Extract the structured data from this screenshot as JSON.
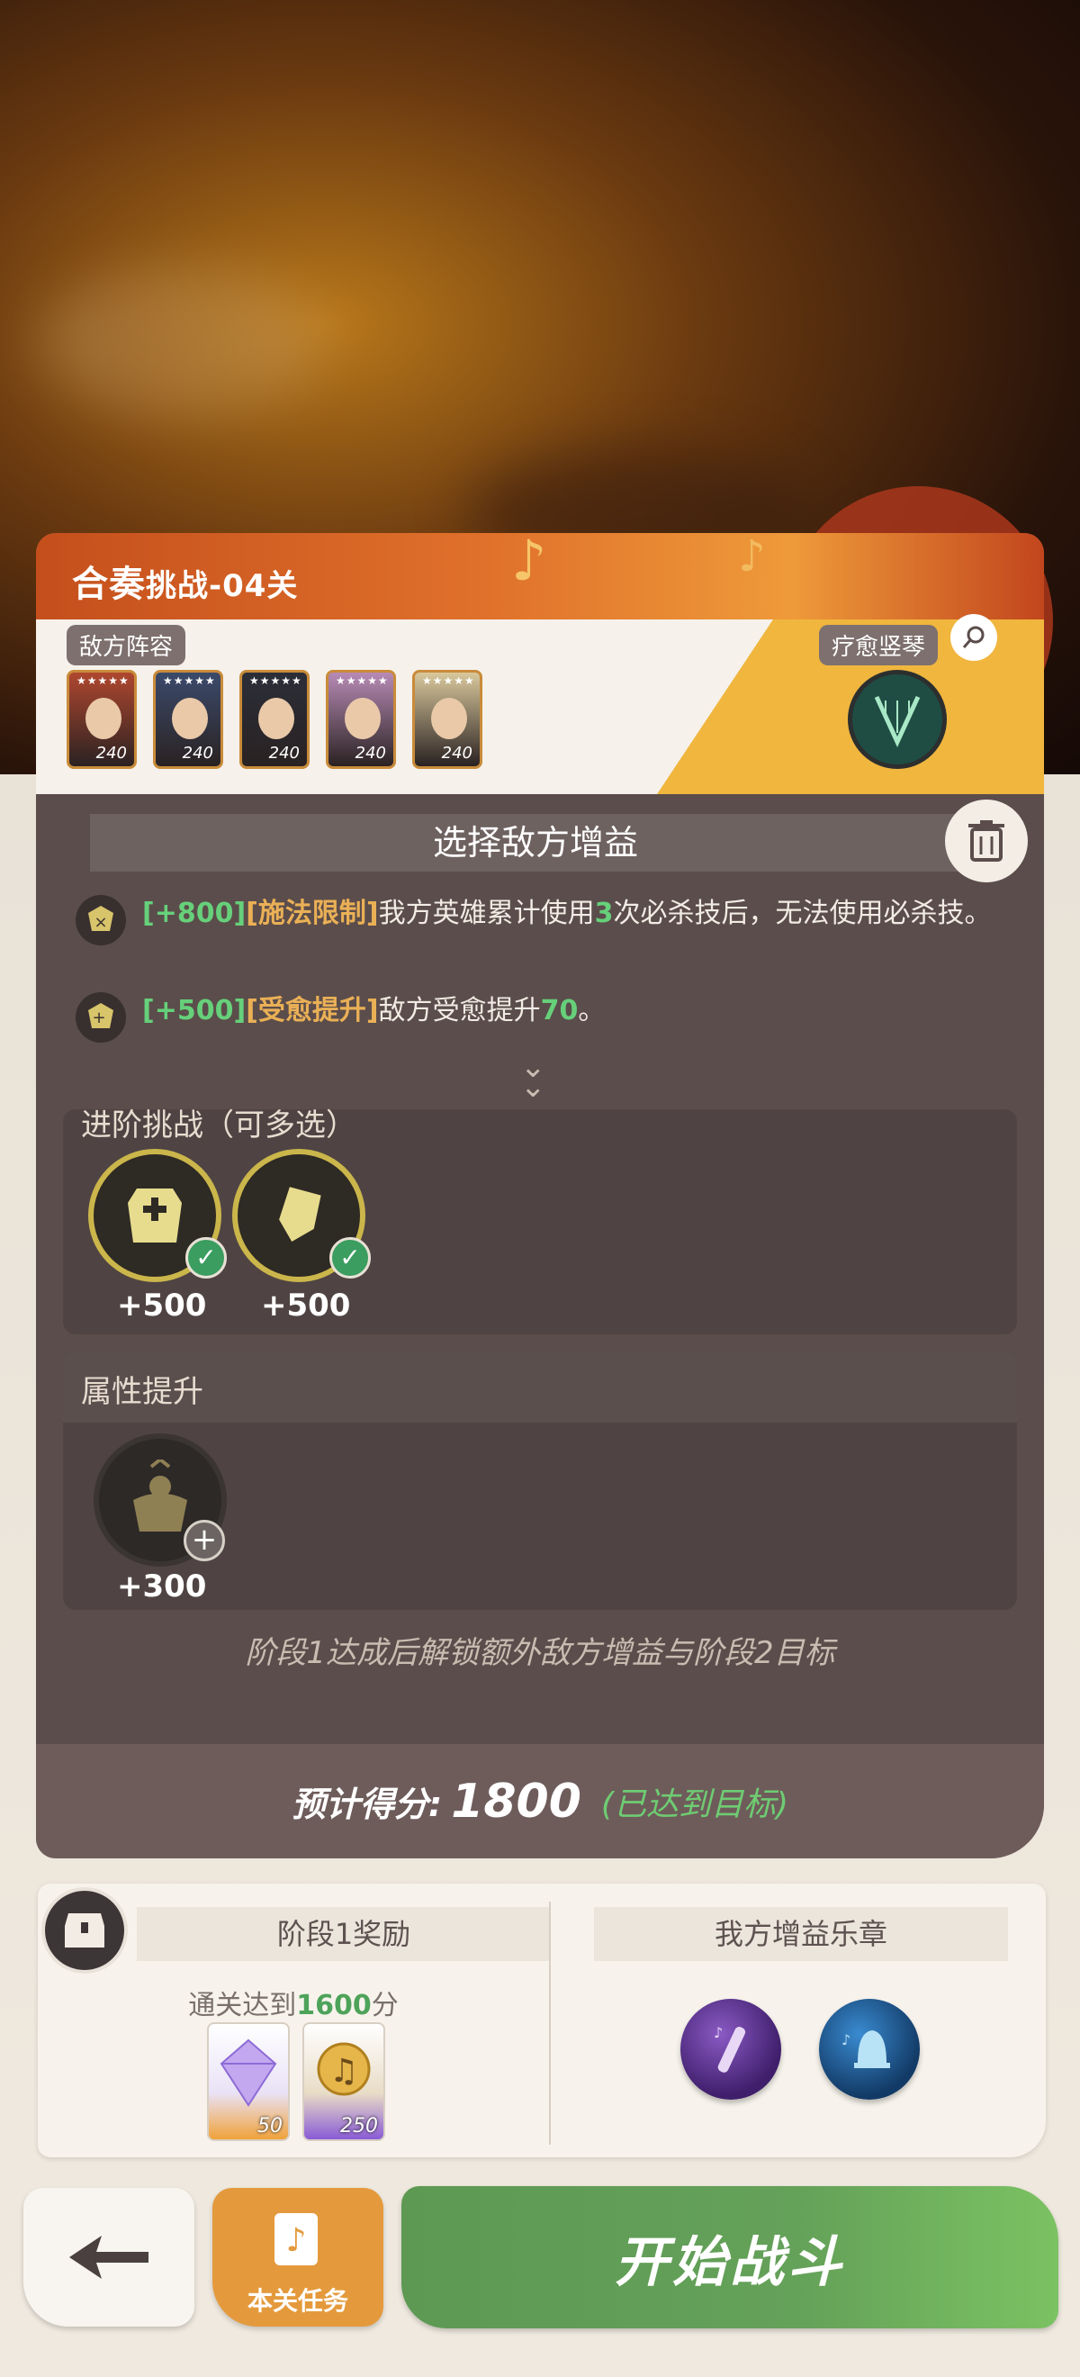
{
  "stage": {
    "title_main": "合奏",
    "title_sub": "挑战-04关"
  },
  "enemy": {
    "label": "敌方阵容",
    "cards": [
      {
        "level": "240",
        "bg": "#b0472f"
      },
      {
        "level": "240",
        "bg": "#3b4a6b"
      },
      {
        "level": "240",
        "bg": "#2b2e38"
      },
      {
        "level": "240",
        "bg": "#b78bb5"
      },
      {
        "level": "240",
        "bg": "#d9c89c"
      }
    ]
  },
  "hero": {
    "label": "疗愈竖琴"
  },
  "buffs": {
    "header": "选择敌方增益",
    "selected": [
      {
        "score": "[+800]",
        "tag": "[施法限制]",
        "text_a": "我方英雄累计使用",
        "count": "3",
        "text_b": "次必杀技后，无法使用必杀技。"
      },
      {
        "score": "[+500]",
        "tag": "[受愈提升]",
        "text_a": "敌方受愈提升",
        "count": "70",
        "text_b": "。"
      }
    ]
  },
  "advanced": {
    "title": "进阶挑战（可多选）",
    "items": [
      {
        "value": "+500",
        "icon": "armor-plus-icon",
        "selected": true
      },
      {
        "value": "+500",
        "icon": "shield-up-icon",
        "selected": true
      }
    ]
  },
  "attribute": {
    "title": "属性提升",
    "items": [
      {
        "value": "+300",
        "icon": "muscle-icon",
        "selected": false
      }
    ]
  },
  "hint": "阶段1达成后解锁额外敌方增益与阶段2目标",
  "score": {
    "label": "预计得分:",
    "value": "1800",
    "status": "(已达到目标)"
  },
  "rewards": {
    "stage_label": "阶段1奖励",
    "requirement_prefix": "通关达到",
    "requirement_value": "1600",
    "requirement_suffix": "分",
    "items": [
      {
        "count": "50",
        "icon": "diamond-icon"
      },
      {
        "count": "250",
        "icon": "music-note-coin-icon"
      }
    ],
    "buff_label": "我方增益乐章"
  },
  "buttons": {
    "task": "本关任务",
    "start": "开始战斗"
  },
  "colors": {
    "green_text": "#66d07a",
    "orange_text": "#eab056",
    "start_green": "#64a159",
    "task_orange": "#e49a3c"
  }
}
